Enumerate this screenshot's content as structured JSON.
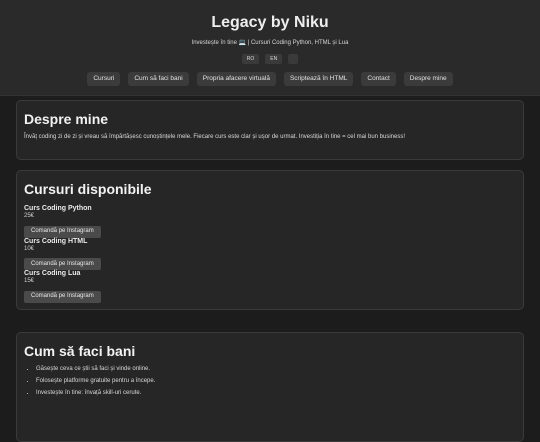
{
  "header": {
    "title": "Legacy by Niku",
    "subtitle": "Investește în tine 💻 | Cursuri Coding Python, HTML și Lua",
    "lang": [
      "RO",
      "EN",
      ""
    ],
    "nav": [
      "Cursuri",
      "Cum să faci bani",
      "Propria afacere virtuală",
      "Scriptează în HTML",
      "Contact",
      "Despre mine"
    ]
  },
  "about": {
    "heading": "Despre mine",
    "text": "Învăț coding zi de zi și vreau să împărtășesc cunoștințele mele. Fiecare curs este clar și ușor de urmat. Investiția în tine = cel mai bun business!"
  },
  "courses": {
    "heading": "Cursuri disponibile",
    "items": [
      {
        "name": "Curs Coding Python",
        "price": "25€",
        "button": "Comandă pe Instagram"
      },
      {
        "name": "Curs Coding HTML",
        "price": "10€",
        "button": "Comandă pe Instagram"
      },
      {
        "name": "Curs Coding Lua",
        "price": "15€",
        "button": "Comandă pe Instagram"
      }
    ]
  },
  "money": {
    "heading": "Cum să faci bani",
    "bullets": [
      "Găsește ceva ce știi să faci și vinde online.",
      "Folosește platforme gratuite pentru a începe.",
      "Investește în tine: învață skill-uri cerute."
    ]
  }
}
